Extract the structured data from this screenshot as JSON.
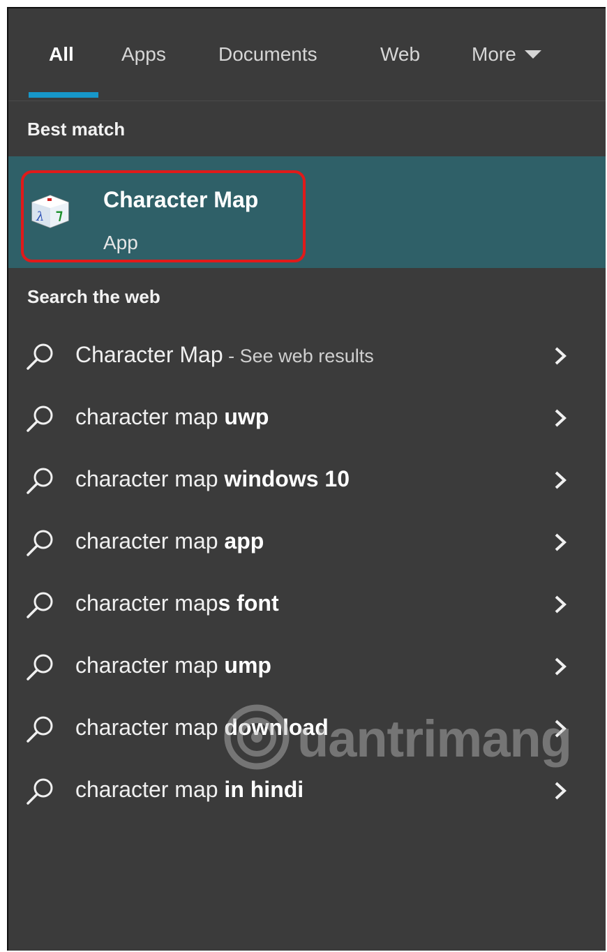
{
  "tabs": [
    {
      "label": "All",
      "active": true
    },
    {
      "label": "Apps"
    },
    {
      "label": "Documents"
    },
    {
      "label": "Web"
    },
    {
      "label": "More"
    }
  ],
  "best_match": {
    "heading": "Best match",
    "title": "Character Map",
    "subtitle": "App"
  },
  "web": {
    "heading": "Search the web",
    "items": [
      {
        "prefix": "Character Map",
        "bold": "",
        "hint": " - See web results"
      },
      {
        "prefix": "character map ",
        "bold": "uwp"
      },
      {
        "prefix": "character map ",
        "bold": "windows 10"
      },
      {
        "prefix": "character map ",
        "bold": "app"
      },
      {
        "prefix": "character map",
        "bold": "s font"
      },
      {
        "prefix": "character map ",
        "bold": "ump"
      },
      {
        "prefix": "character map ",
        "bold": "download"
      },
      {
        "prefix": "character map ",
        "bold": "in hindi"
      }
    ]
  },
  "watermark": {
    "text": "uantrimang"
  },
  "colors": {
    "accent": "#1797c9",
    "selected_bg": "#2f6068",
    "highlight": "#e01a1a",
    "panel_bg": "#3b3b3b"
  }
}
